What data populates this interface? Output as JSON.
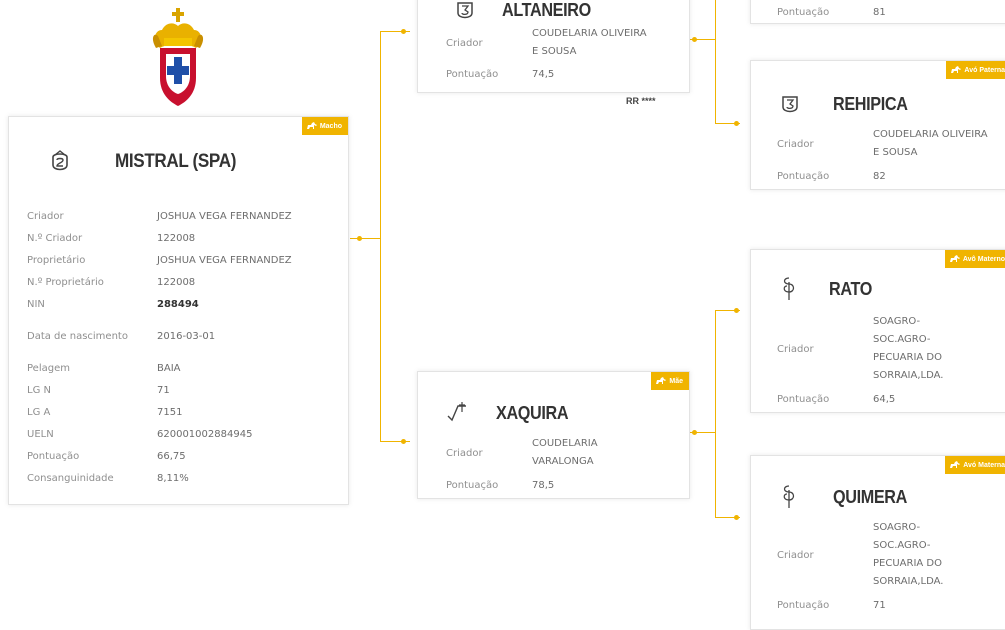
{
  "colors": {
    "accent": "#f0b400",
    "card_border": "#e3e3e3",
    "name": "#333333"
  },
  "subject": {
    "badge": "Macho",
    "icon": "brand-mark-icon",
    "name": "MISTRAL (SPA)",
    "fields": [
      {
        "label": "Criador",
        "value": "JOSHUA VEGA FERNANDEZ"
      },
      {
        "label": "N.º Criador",
        "value": "122008"
      },
      {
        "label": "Proprietário",
        "value": "JOSHUA VEGA FERNANDEZ"
      },
      {
        "label": "N.º Proprietário",
        "value": "122008"
      },
      {
        "label": "NIN",
        "value": "288494"
      },
      {
        "label": "Data de nascimento",
        "value": "2016-03-01"
      },
      {
        "label": "Pelagem",
        "value": "BAIA"
      },
      {
        "label": "LG N",
        "value": "71"
      },
      {
        "label": "LG A",
        "value": "7151"
      },
      {
        "label": "UELN",
        "value": "620001002884945"
      },
      {
        "label": "Pontuação",
        "value": "66,75"
      },
      {
        "label": "Consanguinidade",
        "value": "8,11%"
      }
    ]
  },
  "sire": {
    "name": "ALTANEIRO",
    "breeder_label": "Criador",
    "breeder": "COUDELARIA OLIVEIRA E SOUSA",
    "score_label": "Pontuação",
    "score": "74,5",
    "rating": "RR ****"
  },
  "dam": {
    "badge": "Mãe",
    "name": "XAQUIRA",
    "breeder_label": "Criador",
    "breeder": "COUDELARIA VARALONGA",
    "score_label": "Pontuação",
    "score": "78,5"
  },
  "paternal_grandsire": {
    "score_label": "Pontuação",
    "score": "81"
  },
  "paternal_granddam": {
    "badge": "Avó Paterna",
    "name": "REHIPICA",
    "breeder_label": "Criador",
    "breeder": "COUDELARIA OLIVEIRA E SOUSA",
    "score_label": "Pontuação",
    "score": "82"
  },
  "maternal_grandsire": {
    "badge": "Avô Materno",
    "name": "RATO",
    "breeder_label": "Criador",
    "breeder": "SOAGRO-SOC.AGRO-PECUARIA DO SORRAIA,LDA.",
    "score_label": "Pontuação",
    "score": "64,5"
  },
  "maternal_granddam": {
    "badge": "Avó Materna",
    "name": "QUIMERA",
    "breeder_label": "Criador",
    "breeder": "SOAGRO-SOC.AGRO-PECUARIA DO SORRAIA,LDA.",
    "score_label": "Pontuação",
    "score": "71"
  }
}
